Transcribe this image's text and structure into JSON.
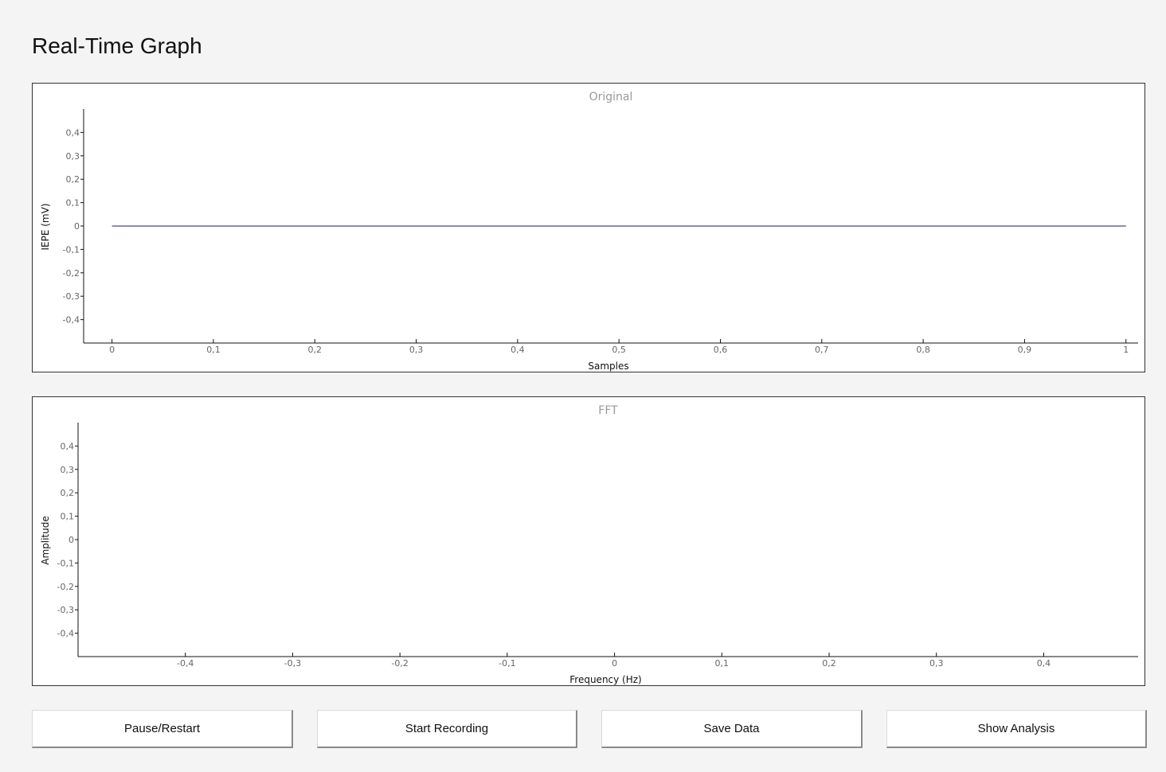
{
  "page": {
    "title": "Real-Time Graph"
  },
  "chart_data": [
    {
      "type": "line",
      "title": "Original",
      "xlabel": "Samples",
      "ylabel": "IEPE (mV)",
      "xlim": [
        -0.028,
        1.012
      ],
      "ylim": [
        -0.5,
        0.5
      ],
      "x_ticks": [
        0,
        0.1,
        0.2,
        0.3,
        0.4,
        0.5,
        0.6,
        0.7,
        0.8,
        0.9,
        1
      ],
      "x_tick_labels": [
        "0",
        "0,1",
        "0,2",
        "0,3",
        "0,4",
        "0,5",
        "0,6",
        "0,7",
        "0,8",
        "0,9",
        "1"
      ],
      "y_ticks": [
        0.4,
        0.3,
        0.2,
        0.1,
        0,
        -0.1,
        -0.2,
        -0.3,
        -0.4
      ],
      "y_tick_labels": [
        "0,4",
        "0,3",
        "0,2",
        "0,1",
        "0",
        "-0,1",
        "-0,2",
        "-0,3",
        "-0,4"
      ],
      "grid": false,
      "series": [
        {
          "x": [
            0,
            1
          ],
          "y": [
            0,
            0
          ],
          "color": "#1a1a66"
        }
      ]
    },
    {
      "type": "line",
      "title": "FFT",
      "xlabel": "Frequency (Hz)",
      "ylabel": "Amplitude",
      "xlim": [
        -0.5,
        0.488
      ],
      "ylim": [
        -0.5,
        0.5
      ],
      "x_ticks": [
        -0.4,
        -0.3,
        -0.2,
        -0.1,
        0,
        0.1,
        0.2,
        0.3,
        0.4
      ],
      "x_tick_labels": [
        "-0,4",
        "-0,3",
        "-0,2",
        "-0,1",
        "0",
        "0,1",
        "0,2",
        "0,3",
        "0,4"
      ],
      "y_ticks": [
        0.4,
        0.3,
        0.2,
        0.1,
        0,
        -0.1,
        -0.2,
        -0.3,
        -0.4
      ],
      "y_tick_labels": [
        "0,4",
        "0,3",
        "0,2",
        "0,1",
        "0",
        "-0,1",
        "-0,2",
        "-0,3",
        "-0,4"
      ],
      "grid": false,
      "series": []
    }
  ],
  "buttons": {
    "pause": "Pause/Restart",
    "record": "Start Recording",
    "save": "Save Data",
    "analysis": "Show Analysis"
  }
}
